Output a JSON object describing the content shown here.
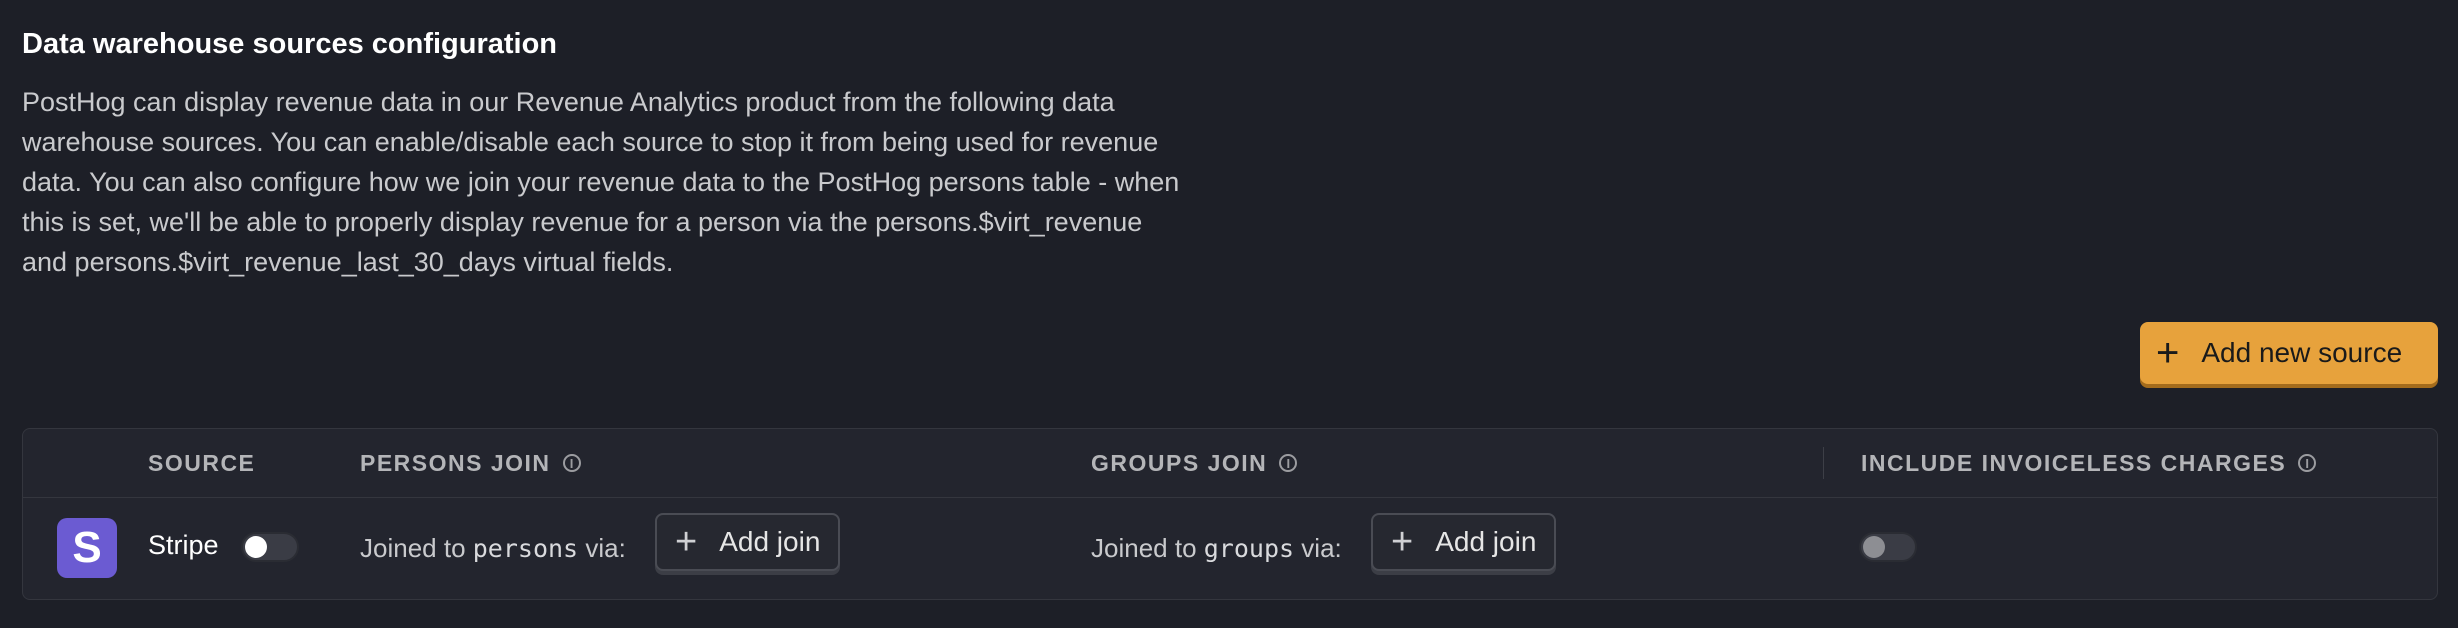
{
  "section": {
    "title": "Data warehouse sources configuration",
    "description": "PostHog can display revenue data in our Revenue Analytics product from the following data warehouse sources. You can enable/disable each source to stop it from being used for revenue data. You can also configure how we join your revenue data to the PostHog persons table - when this is set, we'll be able to properly display revenue for a person via the persons.$virt_revenue and persons.$virt_revenue_last_30_days virtual fields."
  },
  "actions": {
    "add_source_label": "Add new source",
    "add_source_icon": "plus-icon"
  },
  "table": {
    "columns": {
      "source": "SOURCE",
      "persons_join": "PERSONS JOIN",
      "groups_join": "GROUPS JOIN",
      "include_invoiceless": "INCLUDE INVOICELESS CHARGES"
    },
    "info_icon": "info-icon",
    "rows": [
      {
        "logo_letter": "S",
        "logo_color": "#6b5bd2",
        "source_name": "Stripe",
        "enabled": false,
        "persons_join_prefix": "Joined to ",
        "persons_join_target": "persons",
        "persons_join_suffix": " via:",
        "persons_add_join": "Add join",
        "groups_join_prefix": "Joined to ",
        "groups_join_target": "groups",
        "groups_join_suffix": " via:",
        "groups_add_join": "Add join",
        "include_invoiceless": false
      }
    ]
  },
  "colors": {
    "background": "#1d1f27",
    "accent": "#e7a23c",
    "table_bg": "#23252e"
  }
}
